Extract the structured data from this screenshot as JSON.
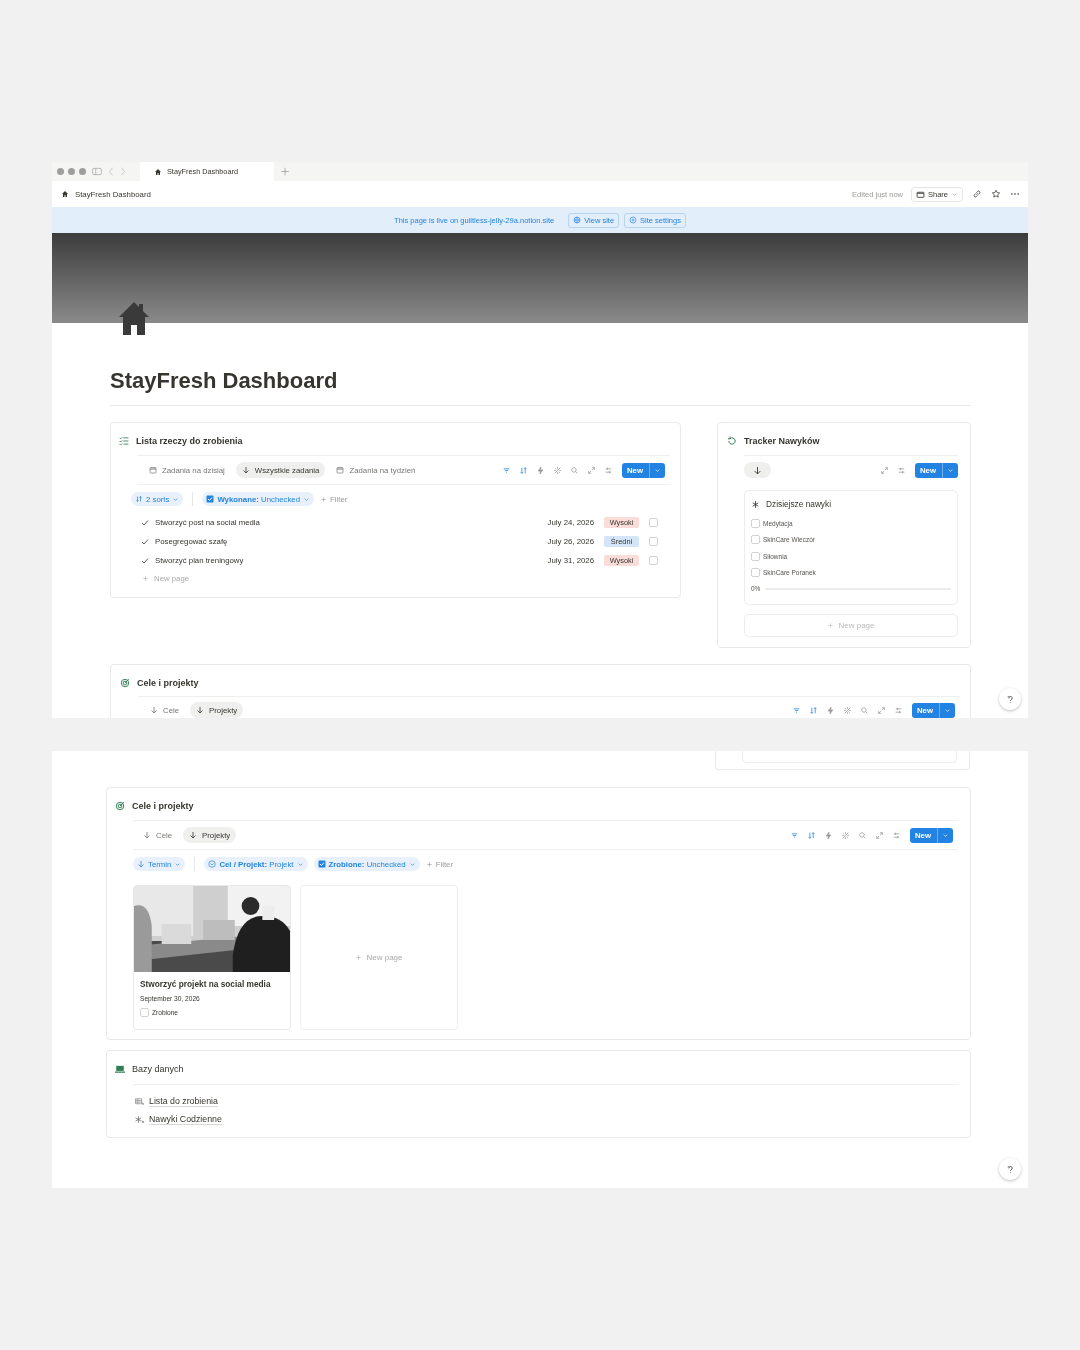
{
  "browser": {
    "tab_title": "StayFresh Dashboard"
  },
  "topbar": {
    "breadcrumb": "StayFresh Dashboard",
    "edited": "Edited just now",
    "share": "Share"
  },
  "banner": {
    "text": "This page is live on guiltless-jelly-29a.notion.site",
    "buttons": [
      {
        "label": "View site",
        "kind": "globe"
      },
      {
        "label": "Site settings",
        "kind": "settings"
      }
    ]
  },
  "page": {
    "title": "StayFresh Dashboard"
  },
  "todo": {
    "title": "Lista rzeczy do zrobienia",
    "new_button": "New",
    "views": [
      {
        "label": "Zadania na dzisiaj",
        "kind": "calendar",
        "selected": false
      },
      {
        "label": "Wszystkie zadania",
        "kind": "arrow",
        "selected": true
      },
      {
        "label": "Zadania na tydzień",
        "kind": "calendar",
        "selected": false
      }
    ],
    "chips": [
      {
        "label": "2 sorts",
        "kind": "sort"
      },
      {
        "label": "**Wykonane:** Unchecked",
        "kind": "checkbox"
      }
    ],
    "add_filter": "Filter",
    "rows": [
      {
        "title": "Stworzyć post na social media",
        "date": "July 24, 2026",
        "priority": "Wysoki",
        "color": "#fadcd9",
        "checked": false
      },
      {
        "title": "Posegregować szafę",
        "date": "July 26, 2026",
        "priority": "Średni",
        "color": "#d3e5f7",
        "checked": false
      },
      {
        "title": "Stworzyć plan treningowy",
        "date": "July 31, 2026",
        "priority": "Wysoki",
        "color": "#fadcd9",
        "checked": false
      }
    ],
    "new_page": "New page"
  },
  "tracker": {
    "title": "Tracker Nawyków",
    "new_button": "New",
    "views": [
      {
        "kind": "arrow",
        "selected": true
      }
    ],
    "habits_title": "Dzisiejsze nawyki",
    "habits": [
      {
        "label": "Medytacja",
        "checked": false
      },
      {
        "label": "SkinCare Wieczór",
        "checked": false
      },
      {
        "label": "Siłownia",
        "checked": false
      },
      {
        "label": "SkinCare Poranek",
        "checked": false
      }
    ],
    "progress": {
      "reading": "0%",
      "level": 0
    },
    "new_page": "New page"
  },
  "goals_preview": {
    "title": "Cele i projekty",
    "new_button": "New",
    "views": [
      {
        "label": "Cele",
        "selected": false
      },
      {
        "label": "Projekty",
        "selected": true
      }
    ]
  },
  "goals": {
    "title": "Cele i projekty",
    "new_button": "New",
    "views": [
      {
        "label": "Cele",
        "selected": false
      },
      {
        "label": "Projekty",
        "selected": true
      }
    ],
    "chips": [
      {
        "label": "Termin",
        "kind": "sort"
      },
      {
        "label": "**Cel / Projekt:** Projekt",
        "kind": "select"
      },
      {
        "label": "**Zrobione:** Unchecked",
        "kind": "checkbox"
      }
    ],
    "add_filter": "Filter",
    "cards": [
      {
        "kind": "picture",
        "title": "Stworzyć projekt na social media",
        "date": "September 30, 2026",
        "property": "Zrobione",
        "checked": false
      }
    ],
    "new_page": "New page"
  },
  "databases": {
    "title": "Bazy danych",
    "links": [
      {
        "label": "Lista do zrobienia",
        "kind": "table"
      },
      {
        "label": "Nawyki Codzienne",
        "kind": "asterisk"
      }
    ]
  }
}
